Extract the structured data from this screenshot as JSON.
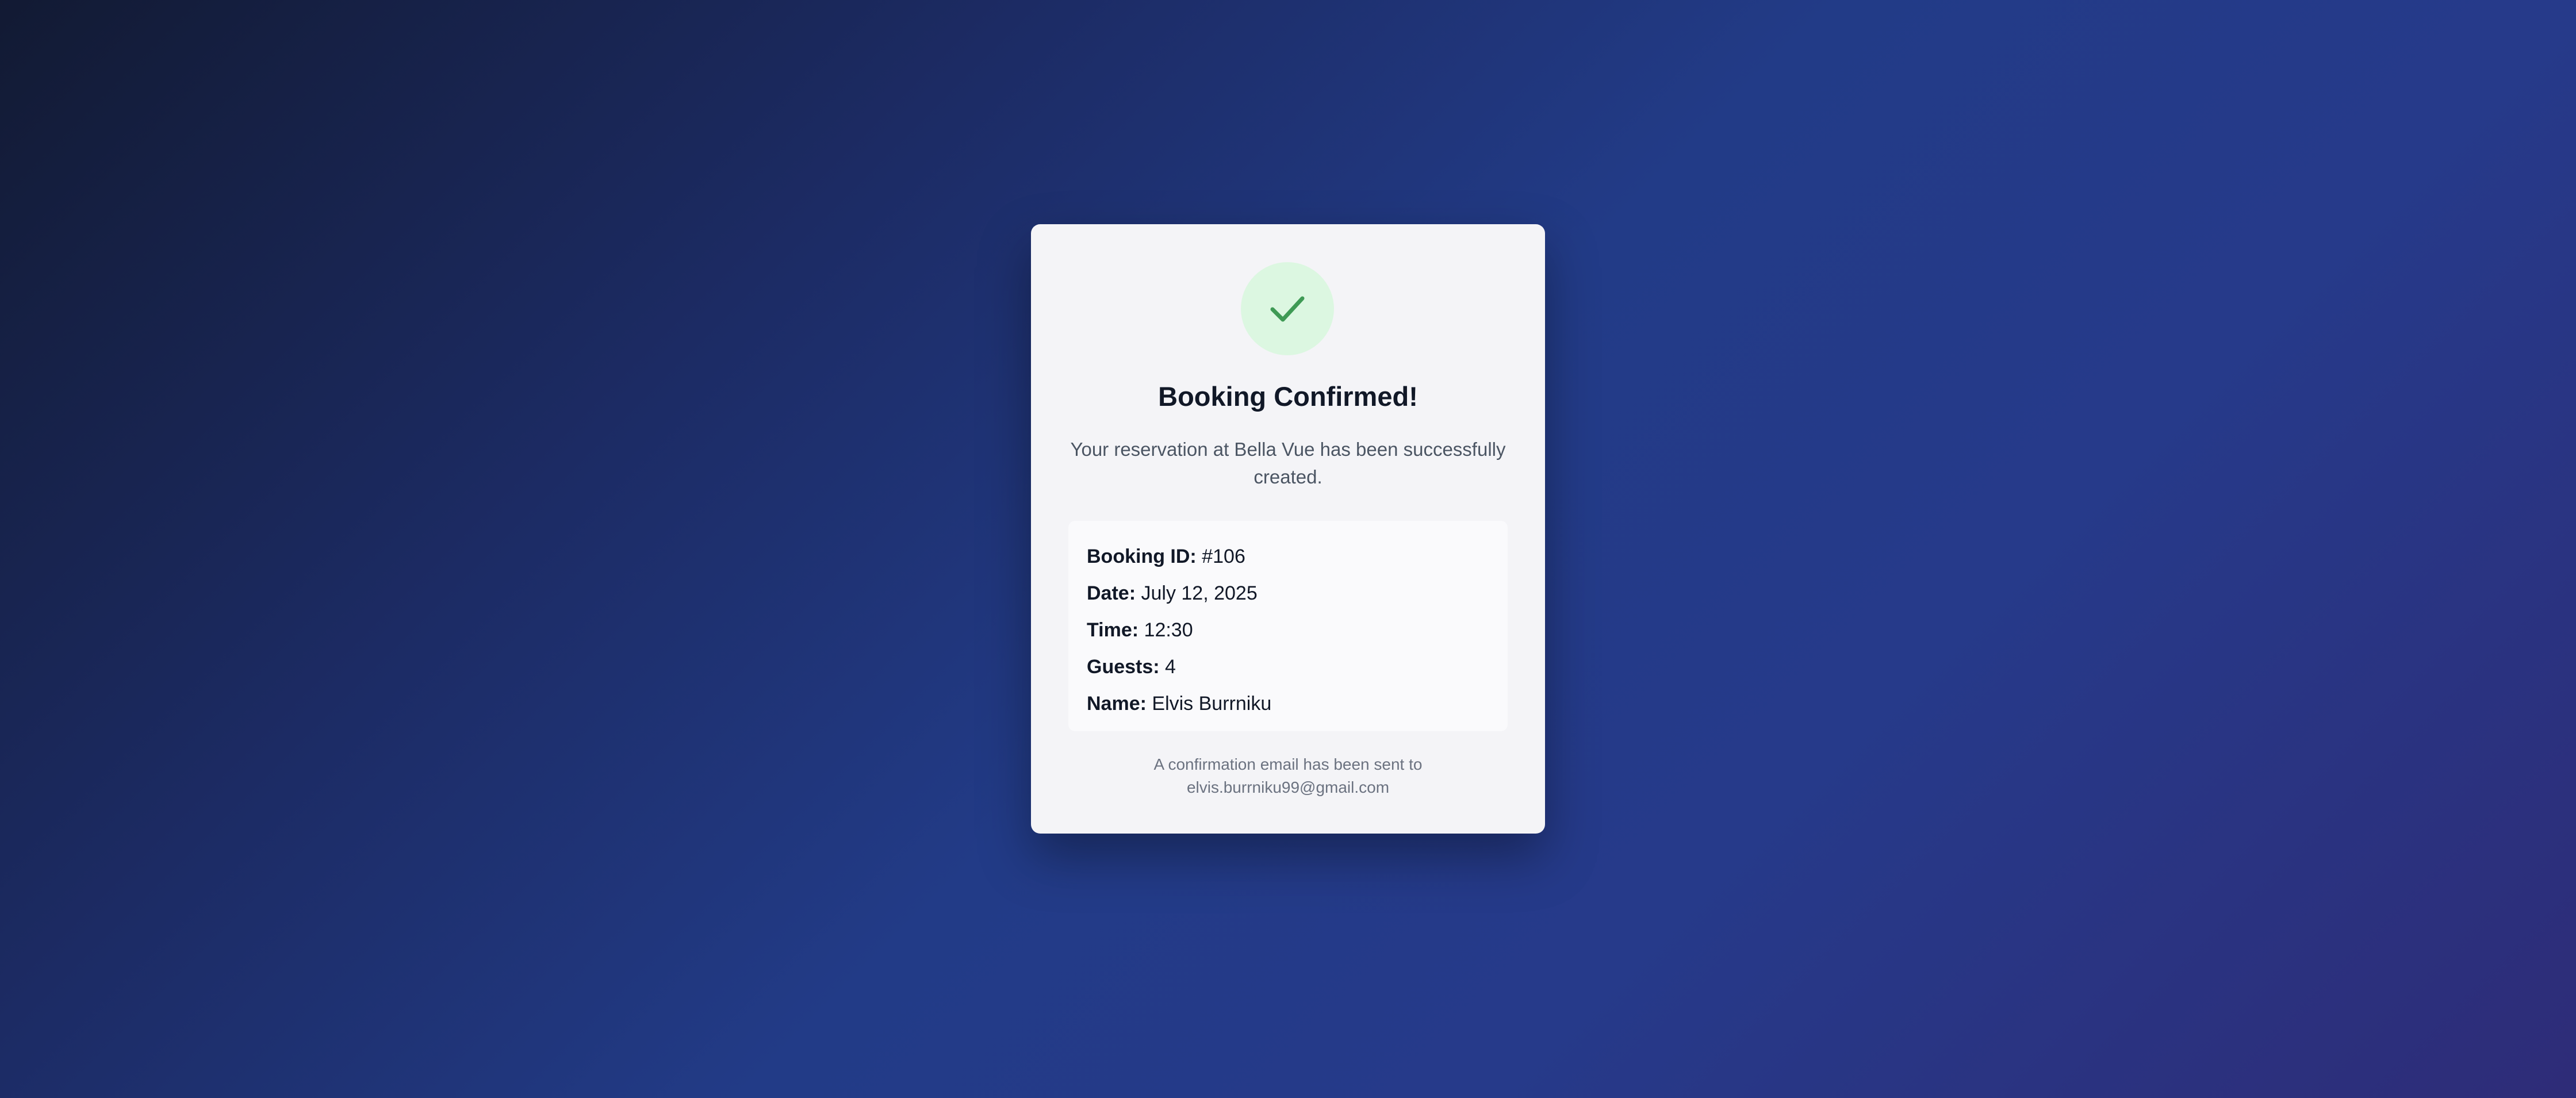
{
  "confirmation": {
    "title": "Booking Confirmed!",
    "message": "Your reservation at Bella Vue has been successfully created.",
    "details": [
      {
        "label": "Booking ID:",
        "value": "#106"
      },
      {
        "label": "Date:",
        "value": "July 12, 2025"
      },
      {
        "label": "Time:",
        "value": "12:30"
      },
      {
        "label": "Guests:",
        "value": "4"
      },
      {
        "label": "Name:",
        "value": "Elvis Burrniku"
      }
    ],
    "email_note_line1": "A confirmation email has been sent to",
    "email_note_line2": "elvis.burrniku99@gmail.com"
  },
  "icons": {
    "status": "check-icon"
  },
  "colors": {
    "success_circle": "#dcf7e1",
    "success_check": "#3f9a55",
    "card_background": "#f4f4f7"
  }
}
